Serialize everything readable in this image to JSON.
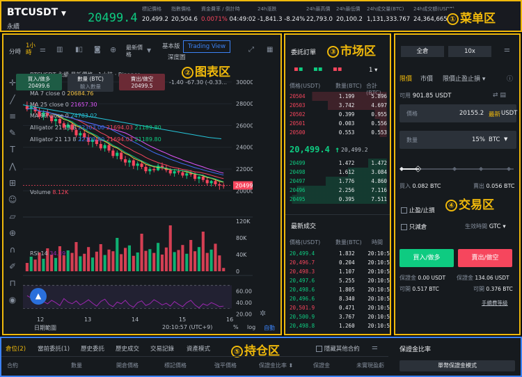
{
  "header": {
    "symbol": "BTCUSDT",
    "contract": "永續",
    "last_price": "20499.4",
    "stats": [
      {
        "label": "標記價格",
        "value": "20,499.2"
      },
      {
        "label": "指數價格",
        "value": "20,504.6"
      },
      {
        "label": "資金費率 / 倒計時",
        "value": "0.0071%",
        "value2": "04:49:02"
      },
      {
        "label": "24h漲跌",
        "value": "-1,841.3 -8.24%"
      },
      {
        "label": "24h最高價",
        "value": "22,793.0"
      },
      {
        "label": "24h最低價",
        "value": "20,100.2"
      },
      {
        "label": "24h成交量(BTC)",
        "value": "1,131,333.767"
      },
      {
        "label": "24h成交額(USDT)",
        "value": "24,364,665,686.07"
      }
    ],
    "region_num": "①",
    "region_label": "菜单区"
  },
  "chart": {
    "region_num": "②",
    "region_label": "图表区",
    "timeframes": [
      "分時",
      "1小時"
    ],
    "indicators_label": "最新價格",
    "view_basic": "基本版",
    "view_depth": "深度圖",
    "view_tv": "Trading View",
    "title": "BTCUSDT 永續 最新價格 · 1小時 · Binance",
    "ohlc_tail": "-1.40 -67.30 (-0.33...",
    "buy_label": "買入/做多",
    "buy_price": "20499.6",
    "qty_label": "數量 (BTC)",
    "qty_hint": "輸入數量",
    "sell_label": "賣出/做空",
    "sell_price": "20499.5",
    "ma": [
      {
        "label": "MA 7 close 0",
        "value": "20684.76",
        "color": "#f6c343"
      },
      {
        "label": "MA 25 close 0",
        "value": "21657.30",
        "color": "#e056fd"
      },
      {
        "label": "MA 99 close 0",
        "value": "24783.02",
        "color": "#26c6da"
      },
      {
        "label": "Alligator 21 13 8",
        "value": "22303.00",
        "value2": "21694.03",
        "value3": "21189.80",
        "color": "#3f6df2"
      },
      {
        "label": "Alligator 21 13 8",
        "value": "22303.80",
        "value2": "21694.03",
        "value3": "21189.80",
        "color": "#3f6df2"
      }
    ],
    "price_axis": [
      "30000.00",
      "28000.00",
      "26000.00",
      "24000.00",
      "22000.00",
      "20000.00"
    ],
    "price_tag": "20499.40",
    "volume_label": "Volume",
    "volume_value": "8.12K",
    "vol_axis": [
      "120K",
      "80K",
      "40K",
      "0"
    ],
    "rsi_label": "RSI 14",
    "rsi_value": "34.39",
    "rsi_axis": [
      "60.00",
      "40.00",
      "20.00"
    ],
    "x_axis": [
      "12",
      "13",
      "14",
      "15",
      "16"
    ],
    "date_range": "日期範圍",
    "time": "20:10:57 (UTC+9)",
    "pct": "%",
    "log": "log",
    "auto": "自動"
  },
  "market": {
    "region_num": "③",
    "region_label": "市场区",
    "orderbook_title": "委託訂單",
    "depth": "1",
    "col_price": "價格(USDT)",
    "col_qty": "數量(BTC)",
    "col_total": "合計(BTC)",
    "asks": [
      [
        "20504",
        "1.199",
        "5.896"
      ],
      [
        "20503",
        "3.742",
        "4.697"
      ],
      [
        "20502",
        "0.399",
        "0.955"
      ],
      [
        "20501",
        "0.003",
        "0.556"
      ],
      [
        "20500",
        "0.553",
        "0.553"
      ]
    ],
    "mid_price": "20,499.4",
    "mid_mark": "20,499.2",
    "bids": [
      [
        "20499",
        "1.472",
        "1.472"
      ],
      [
        "20498",
        "1.612",
        "3.084"
      ],
      [
        "20497",
        "1.776",
        "4.860"
      ],
      [
        "20496",
        "2.256",
        "7.116"
      ],
      [
        "20495",
        "0.395",
        "7.511"
      ]
    ],
    "trades_title": "最新成交",
    "trade_cols": [
      "價格(USDT)",
      "數量(BTC)",
      "時間"
    ],
    "trades": [
      [
        "20,499.4",
        "1.832",
        "20:10:5",
        "g"
      ],
      [
        "20,496.7",
        "0.204",
        "20:10:5",
        "r"
      ],
      [
        "20,498.3",
        "1.107",
        "20:10:5",
        "r"
      ],
      [
        "20,497.6",
        "5.255",
        "20:10:5",
        "g"
      ],
      [
        "20,498.6",
        "1.805",
        "20:10:5",
        "g"
      ],
      [
        "20,496.6",
        "8.340",
        "20:10:5",
        "g"
      ],
      [
        "20,501.9",
        "0.471",
        "20:10:5",
        "r"
      ],
      [
        "20,500.9",
        "3.767",
        "20:10:5",
        "g"
      ],
      [
        "20,498.8",
        "1.260",
        "20:10:5",
        "g"
      ]
    ]
  },
  "trade": {
    "region_num": "④",
    "region_label": "交易区",
    "margin_mode": "全倉",
    "leverage": "10x",
    "order_types": [
      "限價",
      "市價",
      "限價止盈止損"
    ],
    "avail_label": "可用",
    "avail_value": "901.85 USDT",
    "price_label": "價格",
    "price_value": "20155.2",
    "latest": "最新",
    "price_unit": "USDT",
    "qty_label": "數量",
    "qty_pct": "15%",
    "qty_unit": "BTC",
    "buy_qty_label": "買入",
    "buy_qty": "0.082 BTC",
    "sell_qty_label": "賣出",
    "sell_qty": "0.056 BTC",
    "tpsl": "止盈/止損",
    "reduce_only": "只減倉",
    "tif_label": "生效時間",
    "tif_value": "GTC",
    "buy_btn": "買入/做多",
    "sell_btn": "賣出/做空",
    "margin_label": "保證金",
    "buy_margin": "0.00 USDT",
    "sell_margin": "134.06 USDT",
    "max_label": "可開",
    "buy_max": "0.517 BTC",
    "sell_max": "0.376 BTC",
    "fee": "手續費等級"
  },
  "positions": {
    "region_num": "⑤",
    "region_label": "持仓区",
    "tabs": [
      "倉位(2)",
      "當前委託(1)",
      "歷史委託",
      "歷史成交",
      "交易記錄",
      "資產模式"
    ],
    "hide_other": "隱藏其他合約",
    "cols": [
      "合約",
      "數量",
      "開倉價格",
      "標記價格",
      "強平價格",
      "保證金比率",
      "保證金",
      "未實現盈虧"
    ],
    "margin_ratio_title": "保證金比率",
    "single_margin": "單幣保證金模式"
  },
  "chart_data": {
    "type": "candlestick",
    "x_ticks": [
      "12",
      "13",
      "14",
      "15",
      "16"
    ],
    "ylim": [
      19000,
      30500
    ],
    "price_ticks": [
      30000,
      28000,
      26000,
      24000,
      22000,
      20000
    ],
    "ohlc": [
      [
        27800,
        28200,
        27300,
        27500
      ],
      [
        27500,
        27900,
        27000,
        27700
      ],
      [
        27700,
        28000,
        27100,
        27300
      ],
      [
        27300,
        27600,
        26600,
        26800
      ],
      [
        26800,
        27400,
        26500,
        27200
      ],
      [
        27200,
        27500,
        26700,
        26900
      ],
      [
        26900,
        27000,
        26200,
        26400
      ],
      [
        26400,
        26800,
        25900,
        26600
      ],
      [
        26600,
        26900,
        26000,
        26200
      ],
      [
        26200,
        26400,
        25600,
        25800
      ],
      [
        25800,
        26300,
        25500,
        26100
      ],
      [
        26100,
        26300,
        25400,
        25600
      ],
      [
        25600,
        25800,
        24900,
        25100
      ],
      [
        25100,
        25500,
        24600,
        25300
      ],
      [
        25300,
        25600,
        24700,
        24900
      ],
      [
        24900,
        25200,
        24200,
        24500
      ],
      [
        24500,
        24900,
        24000,
        24700
      ],
      [
        24700,
        24900,
        24100,
        24300
      ],
      [
        24300,
        24600,
        23700,
        23900
      ],
      [
        23900,
        24400,
        23600,
        24200
      ],
      [
        24200,
        24400,
        23500,
        23700
      ],
      [
        23700,
        23900,
        23000,
        23200
      ],
      [
        23200,
        23700,
        22900,
        23500
      ],
      [
        23500,
        23700,
        22700,
        22900
      ],
      [
        22900,
        23200,
        22300,
        22600
      ],
      [
        22600,
        23000,
        22200,
        22800
      ],
      [
        22800,
        22900,
        22000,
        22300
      ],
      [
        22300,
        22700,
        21900,
        22500
      ],
      [
        22500,
        22800,
        22000,
        22200
      ],
      [
        22200,
        22400,
        21600,
        21800
      ],
      [
        21800,
        22200,
        21500,
        22000
      ],
      [
        22000,
        22300,
        21700,
        21900
      ],
      [
        21900,
        22500,
        21800,
        22300
      ],
      [
        22300,
        22600,
        21900,
        22100
      ],
      [
        22100,
        22400,
        21700,
        21900
      ],
      [
        21900,
        22100,
        21400,
        21600
      ],
      [
        21600,
        22000,
        21300,
        21800
      ],
      [
        21800,
        22100,
        21500,
        21700
      ],
      [
        21700,
        21900,
        21200,
        21400
      ],
      [
        21400,
        21800,
        21100,
        21600
      ],
      [
        21600,
        21900,
        21300,
        21500
      ],
      [
        21500,
        21700,
        20900,
        21100
      ],
      [
        21100,
        21400,
        20700,
        21300
      ],
      [
        21300,
        21500,
        20800,
        21000
      ],
      [
        21000,
        21200,
        20500,
        20700
      ],
      [
        20700,
        21000,
        20400,
        20900
      ],
      [
        20900,
        21100,
        20400,
        20600
      ],
      [
        20600,
        20800,
        20100,
        20500
      ],
      [
        20500,
        20700,
        20200,
        20499
      ]
    ],
    "ma99": [
      27900,
      27700,
      27500,
      27300,
      27100,
      26900,
      26700,
      26500,
      26300,
      26100,
      25900,
      25700,
      25500,
      25300,
      25100,
      24900,
      24783
    ],
    "volume": [
      20,
      35,
      28,
      45,
      30,
      55,
      40,
      32,
      60,
      38,
      50,
      44,
      70,
      36,
      42,
      58,
      33,
      47,
      65,
      39,
      52,
      48,
      80,
      41,
      56,
      62,
      37,
      45,
      90,
      49,
      53,
      44,
      68,
      40,
      57,
      110,
      46,
      51,
      63,
      42,
      75,
      48,
      58,
      95,
      44,
      52,
      66,
      38,
      8
    ],
    "vol_ticks": [
      "120K",
      "80K",
      "40K",
      "0"
    ],
    "rsi": [
      52,
      48,
      45,
      50,
      42,
      38,
      44,
      40,
      35,
      47,
      41,
      38,
      43,
      36,
      40,
      45,
      39,
      34,
      42,
      46,
      37,
      33,
      41,
      38,
      44,
      36,
      32,
      40,
      43,
      35,
      38,
      45,
      41,
      36,
      39,
      34,
      42,
      37,
      33,
      40,
      44,
      36,
      31,
      38,
      35,
      40,
      37,
      33,
      34
    ],
    "rsi_ticks": [
      60,
      40,
      20
    ]
  }
}
